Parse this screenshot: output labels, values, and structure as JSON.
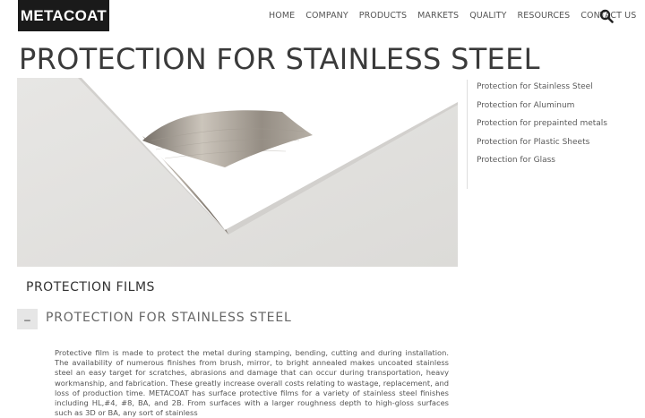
{
  "logo": "METACOAT",
  "nav": [
    "HOME",
    "COMPANY",
    "PRODUCTS",
    "MARKETS",
    "QUALITY",
    "RESOURCES",
    "CONTACT US"
  ],
  "search_icon": "search-icon",
  "title": "PROTECTION FOR STAINLESS STEEL",
  "sidebar": [
    "Protection for Stainless Steel",
    "Protection for Aluminum",
    "Protection for prepainted metals",
    "Protection for Plastic Sheets",
    "Protection for Glass"
  ],
  "section_title": "PROTECTION FILMS",
  "accordion": {
    "toggle": "–",
    "title": "PROTECTION FOR STAINLESS STEEL",
    "body": "Protective film is made to protect the metal during stamping, bending, cutting and during installation. The availability of numerous finishes from brush, mirror, to bright annealed makes uncoated stainless steel an easy target for scratches, abrasions and damage that can occur during transportation, heavy workmanship, and fabrication. These greatly increase overall costs relating to wastage, replacement, and loss of production time. METACOAT has surface protective films for a variety of stainless steel finishes including HL,#4, #8, BA, and 2B. From surfaces with a larger roughness depth to high-gloss surfaces such as 3D or BA, any sort of stainless"
  }
}
